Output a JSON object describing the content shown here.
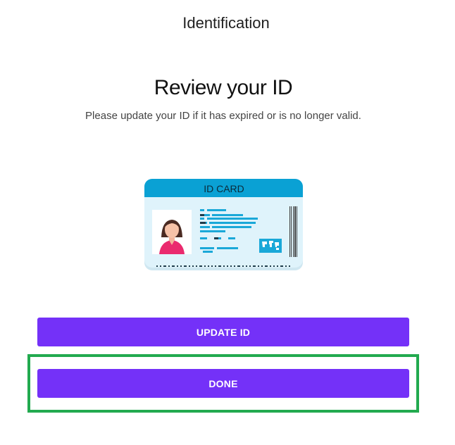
{
  "header": {
    "title": "Identification"
  },
  "main": {
    "title": "Review your ID",
    "subtitle": "Please update your ID if it has expired or is no longer valid."
  },
  "id_card": {
    "label": "ID CARD",
    "icon": "id-card-illustration",
    "colors": {
      "header": "#0aa1d4",
      "body": "#dff3fb",
      "accent": "#1aa8d8"
    }
  },
  "actions": {
    "update_label": "UPDATE ID",
    "done_label": "DONE"
  },
  "colors": {
    "button": "#7431f8",
    "highlight": "#22aa4f"
  }
}
